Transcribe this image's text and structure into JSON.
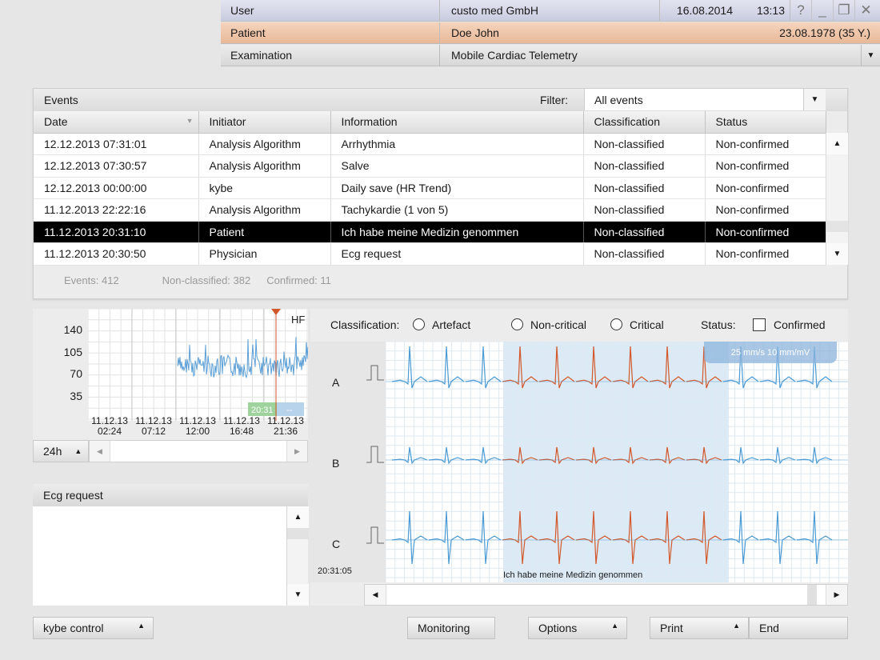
{
  "header": {
    "user_label": "User",
    "user_value": "custo med GmbH",
    "date": "16.08.2014",
    "time": "13:13",
    "help_glyph": "?",
    "minimize_glyph": "_",
    "restore_glyph": "❐",
    "close_glyph": "✕",
    "patient_label": "Patient",
    "patient_name": "Doe John",
    "patient_dob": "23.08.1978 (35 Y.)",
    "exam_label": "Examination",
    "exam_value": "Mobile Cardiac Telemetry",
    "exam_dropdown_icon": "▼"
  },
  "events": {
    "title": "Events",
    "filter_label": "Filter:",
    "filter_value": "All events",
    "filter_dropdown_icon": "▼",
    "columns": [
      "Date",
      "Initiator",
      "Information",
      "Classification",
      "Status"
    ],
    "sort_icon": "▼",
    "rows": [
      {
        "date": "12.12.2013 07:31:01",
        "initiator": "Analysis Algorithm",
        "information": "Arrhythmia",
        "classification": "Non-classified",
        "status": "Non-confirmed"
      },
      {
        "date": "12.12.2013 07:30:57",
        "initiator": "Analysis Algorithm",
        "information": "Salve",
        "classification": "Non-classified",
        "status": "Non-confirmed"
      },
      {
        "date": "12.12.2013 00:00:00",
        "initiator": "kybe",
        "information": "Daily save (HR Trend)",
        "classification": "Non-classified",
        "status": "Non-confirmed"
      },
      {
        "date": "11.12.2013 22:22:16",
        "initiator": "Analysis Algorithm",
        "information": "Tachykardie (1 von 5)",
        "classification": "Non-classified",
        "status": "Non-confirmed"
      },
      {
        "date": "11.12.2013 20:31:10",
        "initiator": "Patient",
        "information": "Ich habe meine Medizin genommen",
        "classification": "Non-classified",
        "status": "Non-confirmed"
      },
      {
        "date": "11.12.2013 20:30:50",
        "initiator": "Physician",
        "information": "Ecg request",
        "classification": "Non-classified",
        "status": "Non-confirmed"
      }
    ],
    "selected_row_index": 4,
    "scroll_up_icon": "▲",
    "scroll_down_icon": "▼",
    "stats": {
      "events": "Events: 412",
      "non_classified": "Non-classified: 382",
      "confirmed": "Confirmed: 11"
    }
  },
  "trend": {
    "series_label": "HF",
    "y_ticks": [
      "140",
      "105",
      "70",
      "35"
    ],
    "x_ticks": [
      {
        "date": "11.12.13",
        "time": "02:24"
      },
      {
        "date": "11.12.13",
        "time": "07:12"
      },
      {
        "date": "11.12.13",
        "time": "12:00"
      },
      {
        "date": "11.12.13",
        "time": "16:48"
      },
      {
        "date": "11.12.13",
        "time": "21:36"
      }
    ],
    "marker_time": "20:31",
    "marker_value": "--",
    "range_label": "24h",
    "range_icon": "▲",
    "scroll_left_icon": "◀",
    "scroll_right_icon": "▶"
  },
  "request": {
    "title": "Ecg request",
    "scroll_up_icon": "▲",
    "scroll_down_icon": "▼"
  },
  "ecg": {
    "classification_label": "Classification:",
    "options": [
      "Artefact",
      "Non-critical",
      "Critical"
    ],
    "status_label": "Status:",
    "confirmed_label": "Confirmed",
    "speed_badge": "25 mm/s 10 mm/mV",
    "leads": [
      "A",
      "B",
      "C"
    ],
    "start_time": "20:31:05",
    "annotation": "Ich habe meine Medizin genommen",
    "scroll_left_icon": "◀",
    "scroll_right_icon": "▶",
    "colors": {
      "normal": "#4a9ad4",
      "event": "#d2572a",
      "highlight": "#d6e6f5"
    }
  },
  "footer": {
    "kybe_control": "kybe control",
    "monitoring": "Monitoring",
    "options": "Options",
    "print": "Print",
    "end": "End",
    "menu_icon": "▲"
  }
}
